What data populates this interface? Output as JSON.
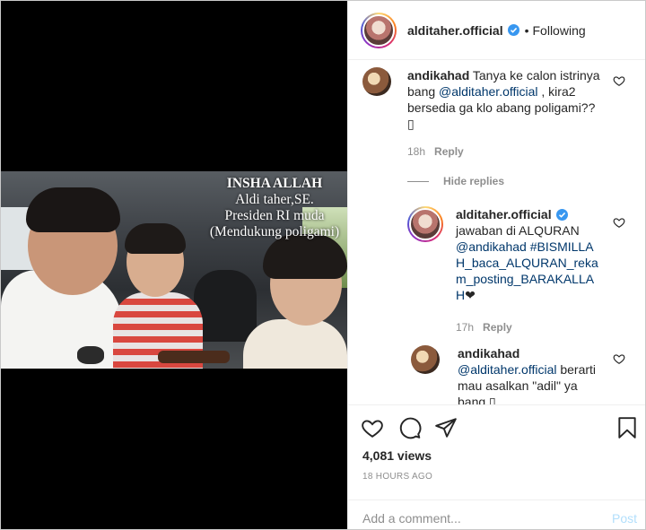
{
  "header": {
    "username": "alditaher.official",
    "separator": "•",
    "follow_status": "Following"
  },
  "video": {
    "overlay_lines": [
      "INSHA ALLAH",
      "Aldi taher,SE.",
      "Presiden RI muda",
      "(Mendukung poligami)"
    ]
  },
  "comments": [
    {
      "username": "andikahad",
      "text": "Tanya ke calon istrinya bang ",
      "mention": "@alditaher.official",
      "text2": " , kira2 bersedia ga klo abang poligami?? ",
      "emoji": "▯",
      "time": "18h",
      "reply_label": "Reply"
    }
  ],
  "hide_replies_label": "Hide replies",
  "replies": [
    {
      "username": "alditaher.official",
      "text": "jawaban di ALQURAN ",
      "mention": "@andikahad",
      "hashtag": " #BISMILLAH_baca_ALQURAN_rekam_posting_BARAKALLAH",
      "emoji": "❤",
      "time": "17h",
      "reply_label": "Reply"
    },
    {
      "username": "andikahad",
      "mention": "@alditaher.official",
      "text": " berarti mau asalkan \"adil\" ya bang ",
      "emoji": "▯"
    }
  ],
  "stats": {
    "views": "4,081 views",
    "timestamp": "18 HOURS AGO"
  },
  "comment_box": {
    "placeholder": "Add a comment...",
    "post_label": "Post"
  },
  "colors": {
    "link": "#00376b",
    "verified": "#3897f0",
    "post_disabled": "#b2dffc"
  }
}
